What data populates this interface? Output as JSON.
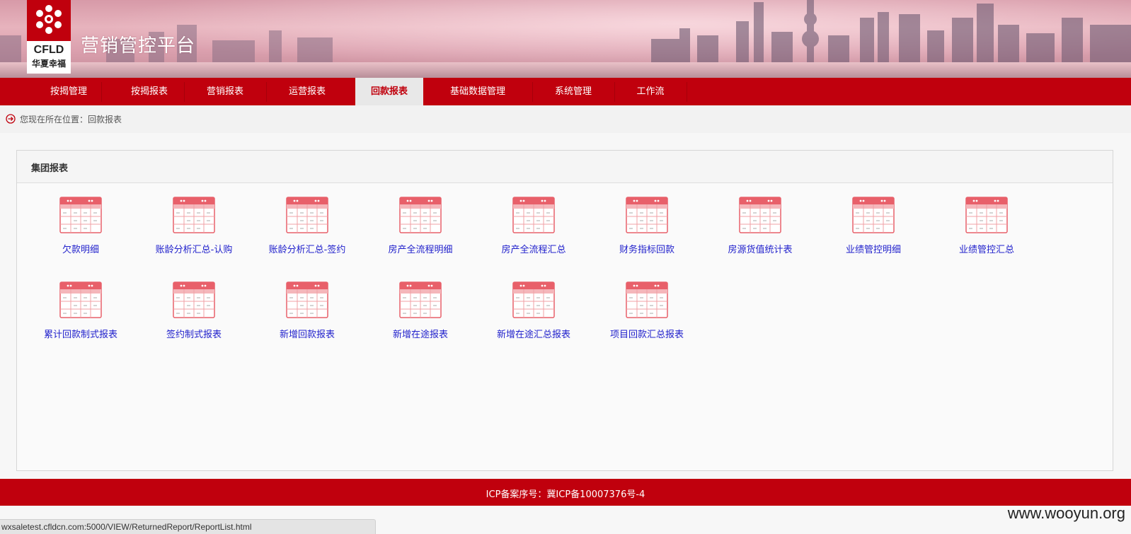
{
  "app": {
    "title": "营销管控平台",
    "logo_text": "CFLD",
    "logo_cn": "华夏幸福"
  },
  "nav": {
    "items": [
      {
        "label": "按揭管理",
        "active": false
      },
      {
        "label": "按揭报表",
        "active": false
      },
      {
        "label": "营销报表",
        "active": false
      },
      {
        "label": "运营报表",
        "active": false
      },
      {
        "label": "回款报表",
        "active": true
      },
      {
        "label": "基础数据管理",
        "active": false
      },
      {
        "label": "系统管理",
        "active": false
      },
      {
        "label": "工作流",
        "active": false
      }
    ]
  },
  "breadcrumb": {
    "icon": "arrow-circle-right-icon",
    "text": "您现在所在位置：回款报表"
  },
  "panel": {
    "title": "集团报表",
    "reports": [
      {
        "label": "欠款明细",
        "icon": "report-table-icon"
      },
      {
        "label": "账龄分析汇总-认购",
        "icon": "report-table-icon"
      },
      {
        "label": "账龄分析汇总-签约",
        "icon": "report-table-icon"
      },
      {
        "label": "房产全流程明细",
        "icon": "report-table-icon"
      },
      {
        "label": "房产全流程汇总",
        "icon": "report-table-icon"
      },
      {
        "label": "财务指标回款",
        "icon": "report-table-icon"
      },
      {
        "label": "房源货值统计表",
        "icon": "report-table-icon"
      },
      {
        "label": "业绩管控明细",
        "icon": "report-table-icon"
      },
      {
        "label": "业绩管控汇总",
        "icon": "report-table-icon"
      },
      {
        "label": "累计回款制式报表",
        "icon": "report-table-icon"
      },
      {
        "label": "签约制式报表",
        "icon": "report-table-icon"
      },
      {
        "label": "新增回款报表",
        "icon": "report-table-icon"
      },
      {
        "label": "新增在途报表",
        "icon": "report-table-icon"
      },
      {
        "label": "新增在途汇总报表",
        "icon": "report-table-icon"
      },
      {
        "label": "项目回款汇总报表",
        "icon": "report-table-icon"
      }
    ]
  },
  "footer": {
    "icp": "ICP备案序号：冀ICP备10007376号-4"
  },
  "status": {
    "url": "wxsaletest.cfldcn.com:5000/VIEW/ReturnedReport/ReportList.html"
  },
  "watermark": "www.wooyun.org",
  "colors": {
    "brand_red": "#c0000d",
    "link_blue": "#2222cc"
  }
}
